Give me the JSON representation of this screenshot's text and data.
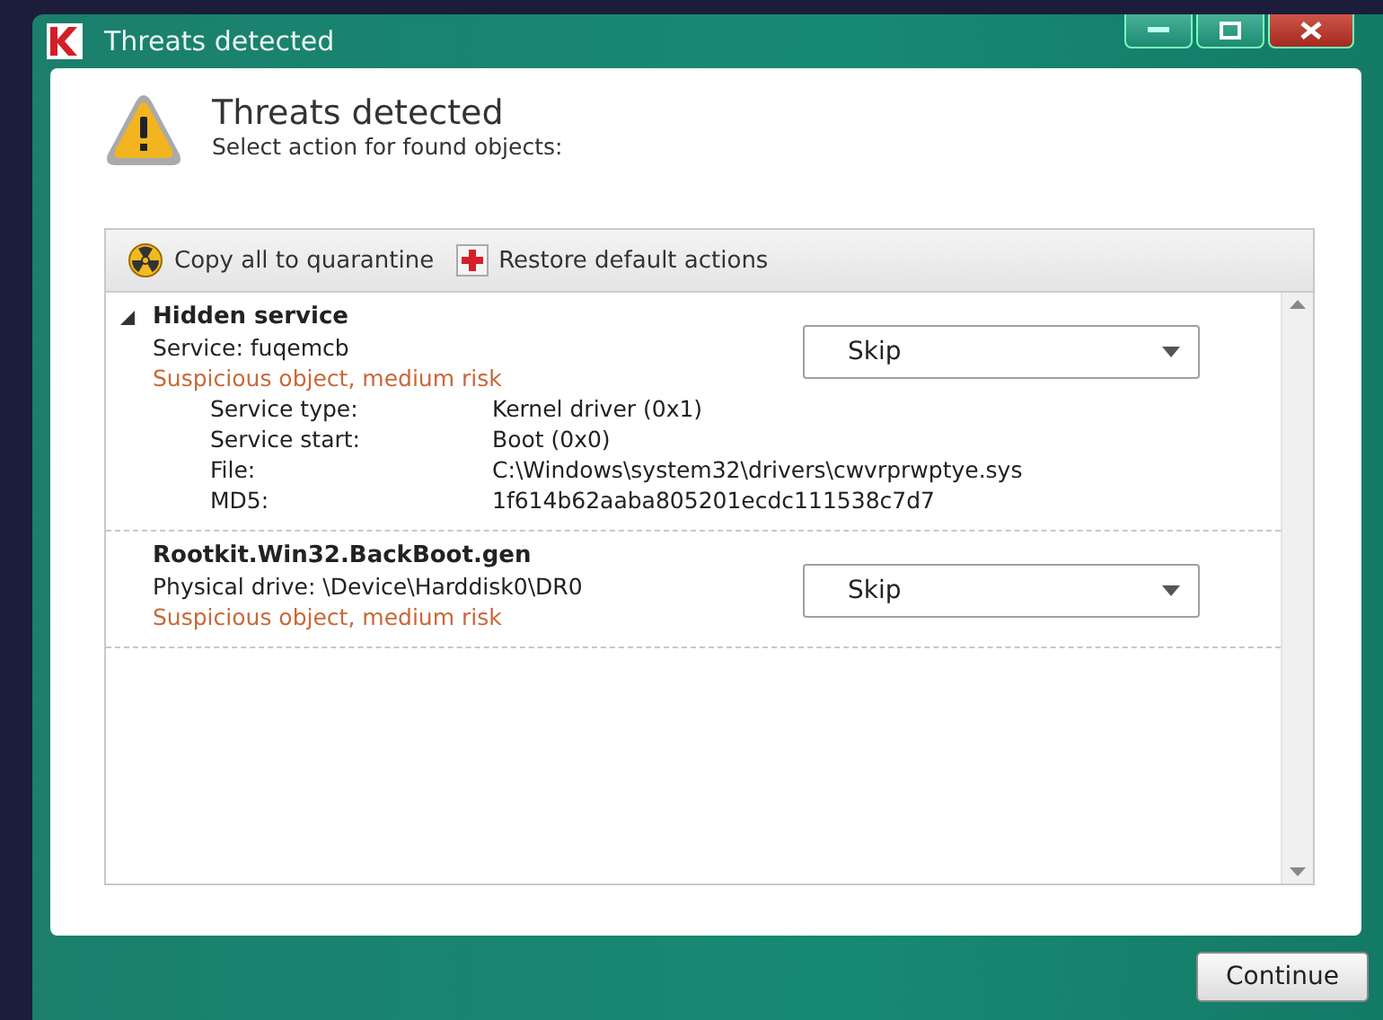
{
  "window": {
    "title": "Threats detected"
  },
  "header": {
    "title": "Threats detected",
    "subtitle": "Select action for found objects:"
  },
  "toolbar": [
    {
      "kind": "quarantine",
      "label": "Copy all to quarantine"
    },
    {
      "kind": "restore",
      "label": "Restore default actions"
    }
  ],
  "threats": [
    {
      "kind": "expandable",
      "expanded": true,
      "name": "Hidden service",
      "object": "Service: fuqemcb",
      "risk": "Suspicious object, medium risk",
      "action": "Skip",
      "details": [
        {
          "label": "Service type:",
          "value": "Kernel driver (0x1)"
        },
        {
          "label": "Service start:",
          "value": "Boot (0x0)"
        },
        {
          "label": "File:",
          "value": "C:\\Windows\\system32\\drivers\\cwvrprwptye.sys"
        },
        {
          "label": "MD5:",
          "value": "1f614b62aaba805201ecdc111538c7d7"
        }
      ]
    },
    {
      "kind": "plain",
      "name": "Rootkit.Win32.BackBoot.gen",
      "object": "Physical drive: \\Device\\Harddisk0\\DR0",
      "risk": "Suspicious object, medium risk",
      "action": "Skip"
    }
  ],
  "buttons": [
    "Continue"
  ]
}
